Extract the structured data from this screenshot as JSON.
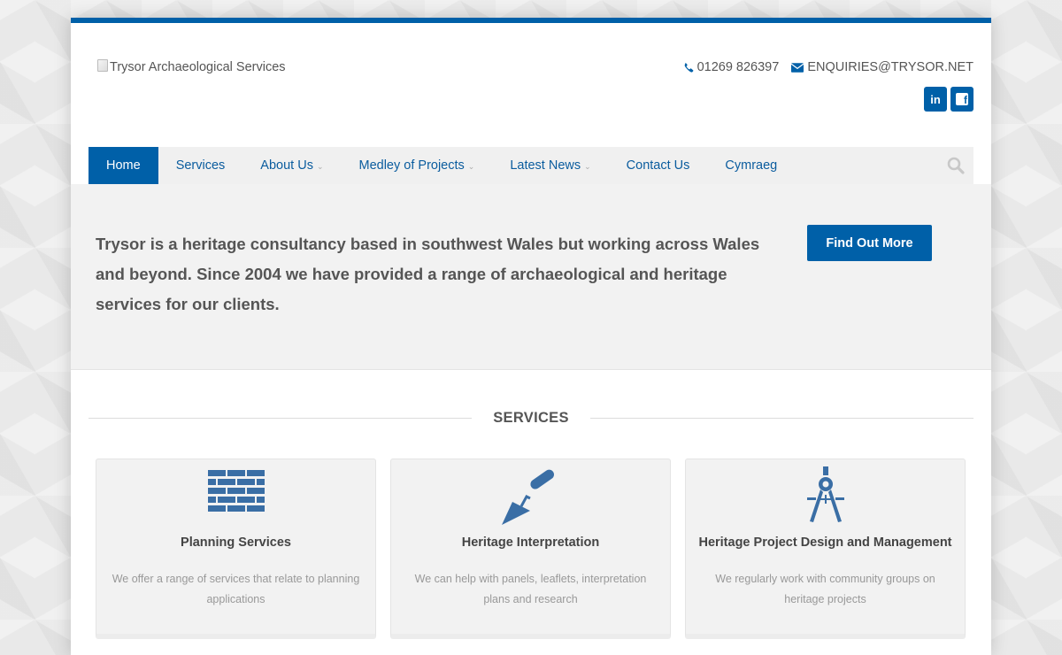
{
  "header": {
    "logo_alt": "Trysor Archaeological Services",
    "phone": "01269 826397",
    "email": "ENQUIRIES@TRYSOR.NET",
    "social": [
      {
        "label": "in",
        "icon": "linkedin-icon"
      },
      {
        "label": "f",
        "icon": "facebook-icon"
      }
    ]
  },
  "nav": {
    "items": [
      {
        "label": "Home",
        "active": true,
        "dropdown": false
      },
      {
        "label": "Services",
        "active": false,
        "dropdown": false
      },
      {
        "label": "About Us",
        "active": false,
        "dropdown": true
      },
      {
        "label": "Medley of Projects",
        "active": false,
        "dropdown": true
      },
      {
        "label": "Latest News",
        "active": false,
        "dropdown": true
      },
      {
        "label": "Contact Us",
        "active": false,
        "dropdown": false
      },
      {
        "label": "Cymraeg",
        "active": false,
        "dropdown": false
      }
    ],
    "search_icon": "search-icon"
  },
  "hero": {
    "text": "Trysor is a heritage consultancy based in southwest Wales but working across Wales and beyond. Since 2004 we have provided a range of archaeological and heritage services for our clients.",
    "button": "Find Out More"
  },
  "services": {
    "heading": "SERVICES",
    "cards": [
      {
        "icon": "brick-wall-icon",
        "title": "Planning Services",
        "description": "We offer a range of services that relate to planning applications"
      },
      {
        "icon": "trowel-icon",
        "title": "Heritage Interpretation",
        "description": "We can help with panels, leaflets, interpretation plans and research"
      },
      {
        "icon": "compass-icon",
        "title": "Heritage Project Design and Management",
        "description": "We regularly work with community groups on heritage projects"
      }
    ]
  },
  "colors": {
    "brand": "#0060a8",
    "nav_bg": "#f0f0f0",
    "hero_bg": "#f2f2f2",
    "text": "#555555"
  }
}
